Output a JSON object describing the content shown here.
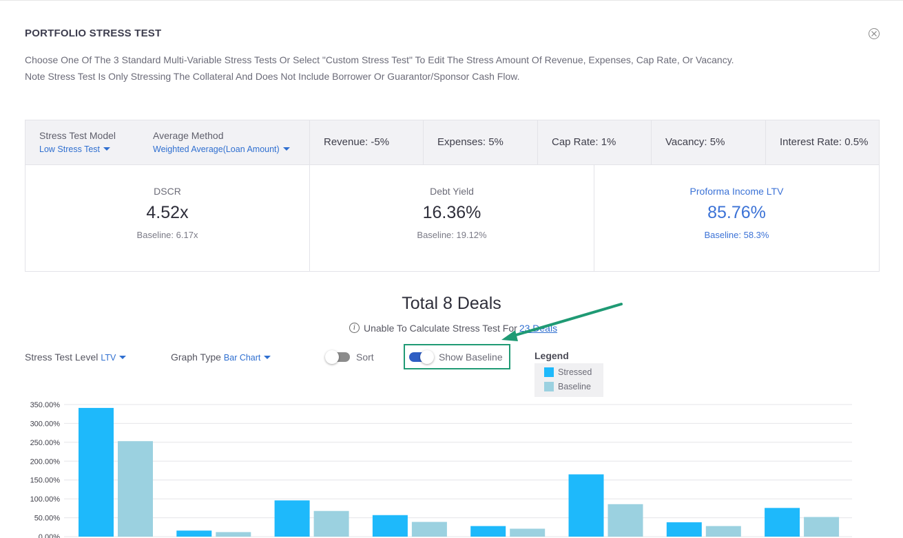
{
  "header": {
    "title": "PORTFOLIO STRESS TEST",
    "close_icon": "close-circle-icon",
    "description_line1": "Choose One Of The 3 Standard Multi-Variable Stress Tests Or Select \"Custom Stress Test\" To Edit The Stress Amount Of Revenue, Expenses, Cap Rate, Or Vacancy.",
    "description_line2": "Note Stress Test Is Only Stressing The Collateral And Does Not Include Borrower Or Guarantor/Sponsor Cash Flow."
  },
  "parameters": {
    "model_label": "Stress Test Model",
    "model_value": "Low Stress Test",
    "method_label": "Average Method",
    "method_value": "Weighted Average(Loan Amount)",
    "revenue": "Revenue: -5%",
    "expenses": "Expenses: 5%",
    "cap_rate": "Cap Rate: 1%",
    "vacancy": "Vacancy: 5%",
    "interest_rate": "Interest Rate: 0.5%"
  },
  "metrics": [
    {
      "label": "DSCR",
      "value": "4.52x",
      "baseline": "Baseline: 6.17x"
    },
    {
      "label": "Debt Yield",
      "value": "16.36%",
      "baseline": "Baseline: 19.12%"
    },
    {
      "label": "Proforma Income LTV",
      "value": "85.76%",
      "baseline": "Baseline: 58.3%"
    }
  ],
  "summary": {
    "total": "Total 8 Deals",
    "unable_text": "Unable To Calculate Stress Test For",
    "unable_link": "23 Deals",
    "info_icon": "info-icon"
  },
  "controls": {
    "level_label": "Stress Test Level",
    "level_value": "LTV",
    "graph_label": "Graph Type",
    "graph_value": "Bar Chart",
    "sort_label": "Sort",
    "sort_on": false,
    "baseline_label": "Show Baseline",
    "baseline_on": true
  },
  "legend": {
    "title": "Legend",
    "items": [
      {
        "label": "Stressed",
        "color": "#1eb9fb"
      },
      {
        "label": "Baseline",
        "color": "#9bd1e0"
      }
    ]
  },
  "colors": {
    "accent": "#2f6fd0",
    "highlight_box": "#1f9a74"
  },
  "chart_data": {
    "type": "bar",
    "ylim": [
      0,
      350
    ],
    "y_ticks": [
      "350.00%",
      "300.00%",
      "250.00%",
      "200.00%",
      "150.00%",
      "100.00%",
      "50.00%",
      "0.00%"
    ],
    "y_tick_values": [
      350,
      300,
      250,
      200,
      150,
      100,
      50,
      0
    ],
    "grid": true,
    "legend_placement": "top",
    "categories": [
      "",
      "",
      "",
      "",
      "",
      "",
      "",
      ""
    ],
    "series": [
      {
        "name": "Stressed",
        "color": "#1eb9fb",
        "values": [
          341,
          16,
          96,
          57,
          28,
          165,
          38,
          76
        ]
      },
      {
        "name": "Baseline",
        "color": "#9bd1e0",
        "values": [
          253,
          12,
          68,
          39,
          21,
          86,
          28,
          52
        ]
      }
    ]
  }
}
